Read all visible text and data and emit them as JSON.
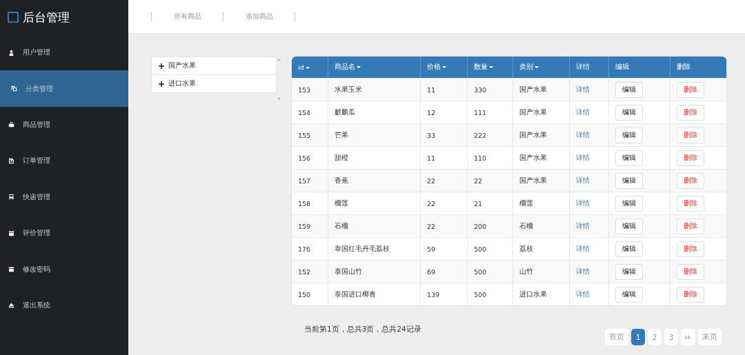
{
  "brand": {
    "title": "后台管理"
  },
  "sidebar": {
    "items": [
      {
        "label": "用户管理",
        "selected": false
      },
      {
        "label": "分类管理",
        "selected": true
      },
      {
        "label": "商品管理",
        "selected": false
      },
      {
        "label": "订单管理",
        "selected": false
      },
      {
        "label": "快递管理",
        "selected": false
      },
      {
        "label": "评价管理",
        "selected": false
      },
      {
        "label": "修改密码",
        "selected": false
      },
      {
        "label": "退出系统",
        "selected": false
      }
    ]
  },
  "top_tabs": [
    "所有商品",
    "添加商品"
  ],
  "categories": [
    {
      "label": "国产水果"
    },
    {
      "label": "进口水果"
    }
  ],
  "table": {
    "columns": [
      {
        "label": "id",
        "sortable": true
      },
      {
        "label": "商品名",
        "sortable": true
      },
      {
        "label": "价格",
        "sortable": true
      },
      {
        "label": "数量",
        "sortable": true
      },
      {
        "label": "类别",
        "sortable": true
      },
      {
        "label": "详情",
        "sortable": false
      },
      {
        "label": "编辑",
        "sortable": false
      },
      {
        "label": "删除",
        "sortable": false
      }
    ],
    "rows": [
      {
        "id": "153",
        "name": "水果玉米",
        "price": "11",
        "qty": "330",
        "category": "国产水果",
        "detail": "详情",
        "edit": "编辑",
        "delete": "删除"
      },
      {
        "id": "154",
        "name": "麒麟瓜",
        "price": "12",
        "qty": "111",
        "category": "国产水果",
        "detail": "详情",
        "edit": "编辑",
        "delete": "删除"
      },
      {
        "id": "155",
        "name": "芒果",
        "price": "33",
        "qty": "222",
        "category": "国产水果",
        "detail": "详情",
        "edit": "编辑",
        "delete": "删除"
      },
      {
        "id": "156",
        "name": "甜橙",
        "price": "11",
        "qty": "110",
        "category": "国产水果",
        "detail": "详情",
        "edit": "编辑",
        "delete": "删除"
      },
      {
        "id": "157",
        "name": "香蕉",
        "price": "22",
        "qty": "22",
        "category": "国产水果",
        "detail": "详情",
        "edit": "编辑",
        "delete": "删除"
      },
      {
        "id": "158",
        "name": "榴莲",
        "price": "22",
        "qty": "21",
        "category": "榴莲",
        "detail": "详情",
        "edit": "编辑",
        "delete": "删除"
      },
      {
        "id": "159",
        "name": "石榴",
        "price": "22",
        "qty": "200",
        "category": "石榴",
        "detail": "详情",
        "edit": "编辑",
        "delete": "删除"
      },
      {
        "id": "176",
        "name": "泰国红毛丹毛荔枝",
        "price": "59",
        "qty": "500",
        "category": "荔枝",
        "detail": "详情",
        "edit": "编辑",
        "delete": "删除"
      },
      {
        "id": "152",
        "name": "泰国山竹",
        "price": "69",
        "qty": "500",
        "category": "山竹",
        "detail": "详情",
        "edit": "编辑",
        "delete": "删除"
      },
      {
        "id": "150",
        "name": "泰国进口椰青",
        "price": "139",
        "qty": "500",
        "category": "进口水果",
        "detail": "详情",
        "edit": "编辑",
        "delete": "删除"
      }
    ]
  },
  "footer": {
    "summary": "当前第1页，总共3页，总共24记录"
  },
  "pagination": [
    {
      "kind": "text",
      "label": "首页",
      "selected": false
    },
    {
      "kind": "text",
      "label": "1",
      "selected": true
    },
    {
      "kind": "text",
      "label": "2",
      "selected": false
    },
    {
      "kind": "text",
      "label": "3",
      "selected": false
    },
    {
      "kind": "next",
      "selected": false
    },
    {
      "kind": "text",
      "label": "末页",
      "selected": false
    }
  ]
}
